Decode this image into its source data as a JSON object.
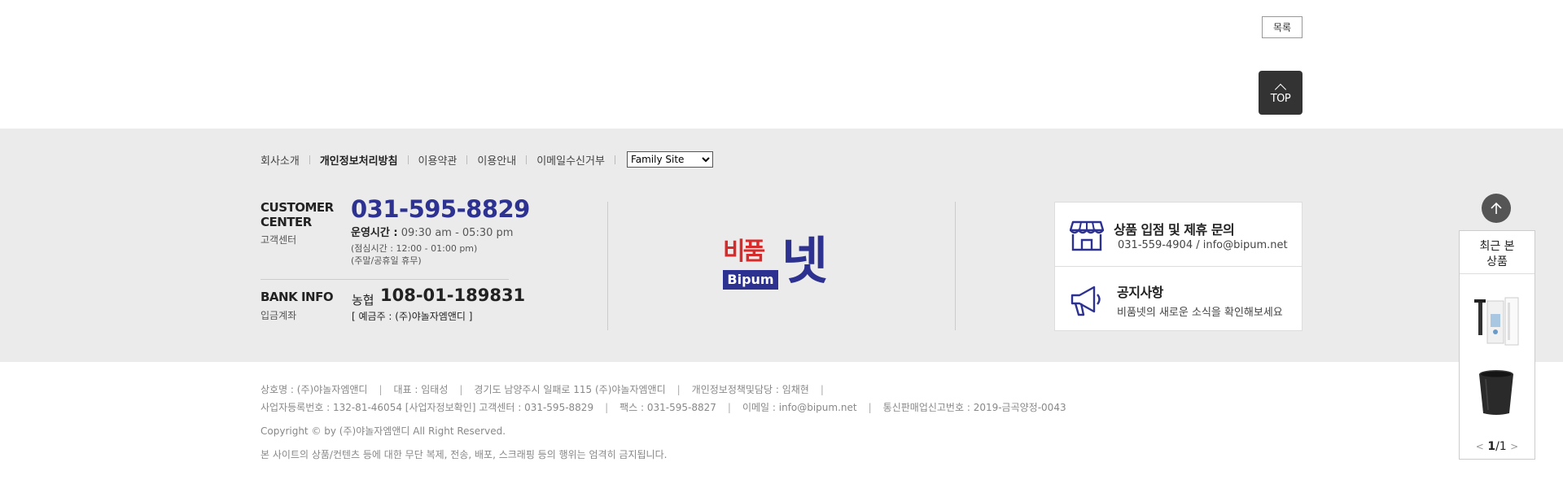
{
  "top_buttons": {
    "list_label": "목록",
    "top_label": "TOP"
  },
  "nav": {
    "items": [
      "회사소개",
      "개인정보처리방침",
      "이용약관",
      "이용안내",
      "이메일수신거부"
    ],
    "family_site": "Family Site"
  },
  "customer_center": {
    "title": "CUSTOMER CENTER",
    "subtitle": "고객센터",
    "phone": "031-595-8829",
    "hours_label": "운영시간 :",
    "hours": "09:30 am - 05:30 pm",
    "lunch": "(점심시간 : 12:00 - 01:00 pm)",
    "holiday": "(주말/공휴일 휴무)"
  },
  "bank_info": {
    "title": "BANK INFO",
    "subtitle": "입금계좌",
    "bank": "농협",
    "account": "108-01-189831",
    "holder": "[ 예금주 : (주)야놀자엠앤디 ]"
  },
  "logo": {
    "main": "비품",
    "sub": "Bipum",
    "net": "넷"
  },
  "info_box": {
    "partner_title": "상품 입점 및 제휴 문의",
    "partner_contact": "031-559-4904 / info@bipum.net",
    "notice_title": "공지사항",
    "notice_desc": "비품넷의 새로운 소식을 확인해보세요"
  },
  "company": {
    "name": "상호명 : (주)야놀자엠앤디",
    "ceo": "대표 : 임태성",
    "address": "경기도 남양주시 일패로 115 (주)야놀자엠앤디",
    "privacy_officer": "개인정보정책및담당 : 임채현",
    "biz_no": "사업자등록번호 : 132-81-46054 [사업자정보확인] 고객센터 : 031-595-8829",
    "fax": "팩스 : 031-595-8827",
    "email": "이메일 : info@bipum.net",
    "ecommerce_no": "통신판매업신고번호 : 2019-금곡양정-0043",
    "copyright": "Copyright © by (주)야놀자엠앤디 All Right Reserved.",
    "notice": "본 사이트의 상품/컨텐츠 등에 대한 무단 복제, 전송, 배포, 스크래핑 등의 행위는 엄격히 금지됩니다."
  },
  "recent": {
    "title": "최근 본 상품",
    "page_current": "1",
    "page_total": "/1"
  },
  "colors": {
    "brand_navy": "#2d3290",
    "brand_red": "#d72b2b",
    "footer_bg": "#ebebeb"
  }
}
